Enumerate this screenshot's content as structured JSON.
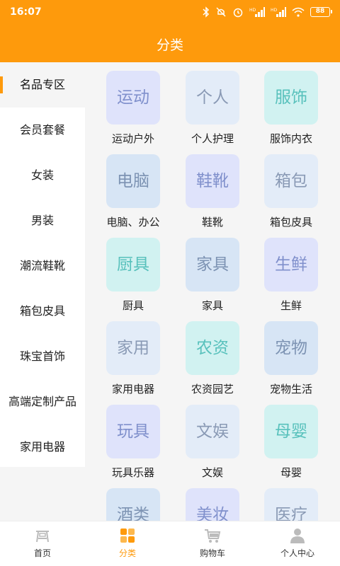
{
  "status_bar": {
    "time": "16:07",
    "battery": "88"
  },
  "header": {
    "title": "分类"
  },
  "sidebar": {
    "items": [
      {
        "label": "名品专区",
        "active": true
      },
      {
        "label": "会员套餐"
      },
      {
        "label": "女装"
      },
      {
        "label": "男装"
      },
      {
        "label": "潮流鞋靴"
      },
      {
        "label": "箱包皮具"
      },
      {
        "label": "珠宝首饰"
      },
      {
        "label": "高端定制产品"
      },
      {
        "label": "家用电器"
      }
    ]
  },
  "categories": [
    {
      "tile": "运动",
      "label": "运动户外",
      "color": "#dfe3fb"
    },
    {
      "tile": "个人",
      "label": "个人护理",
      "color": "#e3ecf8"
    },
    {
      "tile": "服饰",
      "label": "服饰内衣",
      "color": "#d1f2f1"
    },
    {
      "tile": "电脑",
      "label": "电脑、办公",
      "color": "#d7e5f5"
    },
    {
      "tile": "鞋靴",
      "label": "鞋靴",
      "color": "#dfe3fb"
    },
    {
      "tile": "箱包",
      "label": "箱包皮具",
      "color": "#e3ecf8"
    },
    {
      "tile": "厨具",
      "label": "厨具",
      "color": "#d1f2f1"
    },
    {
      "tile": "家具",
      "label": "家具",
      "color": "#d7e5f5"
    },
    {
      "tile": "生鲜",
      "label": "生鲜",
      "color": "#dfe3fb"
    },
    {
      "tile": "家用",
      "label": "家用电器",
      "color": "#e3ecf8"
    },
    {
      "tile": "农资",
      "label": "农资园艺",
      "color": "#d1f2f1"
    },
    {
      "tile": "宠物",
      "label": "宠物生活",
      "color": "#d7e5f5"
    },
    {
      "tile": "玩具",
      "label": "玩具乐器",
      "color": "#dfe3fb"
    },
    {
      "tile": "文娱",
      "label": "文娱",
      "color": "#e3ecf8"
    },
    {
      "tile": "母婴",
      "label": "母婴",
      "color": "#d1f2f1"
    },
    {
      "tile": "酒类",
      "label": "",
      "color": "#d7e5f5"
    },
    {
      "tile": "美妆",
      "label": "",
      "color": "#dfe3fb"
    },
    {
      "tile": "医疗",
      "label": "",
      "color": "#e3ecf8"
    }
  ],
  "tabbar": {
    "items": [
      {
        "label": "首页",
        "icon": "home-icon"
      },
      {
        "label": "分类",
        "icon": "category-icon",
        "active": true
      },
      {
        "label": "购物车",
        "icon": "cart-icon"
      },
      {
        "label": "个人中心",
        "icon": "user-icon"
      }
    ]
  },
  "colors": {
    "accent": "#fe9a0c",
    "background": "#f5f5f5"
  }
}
